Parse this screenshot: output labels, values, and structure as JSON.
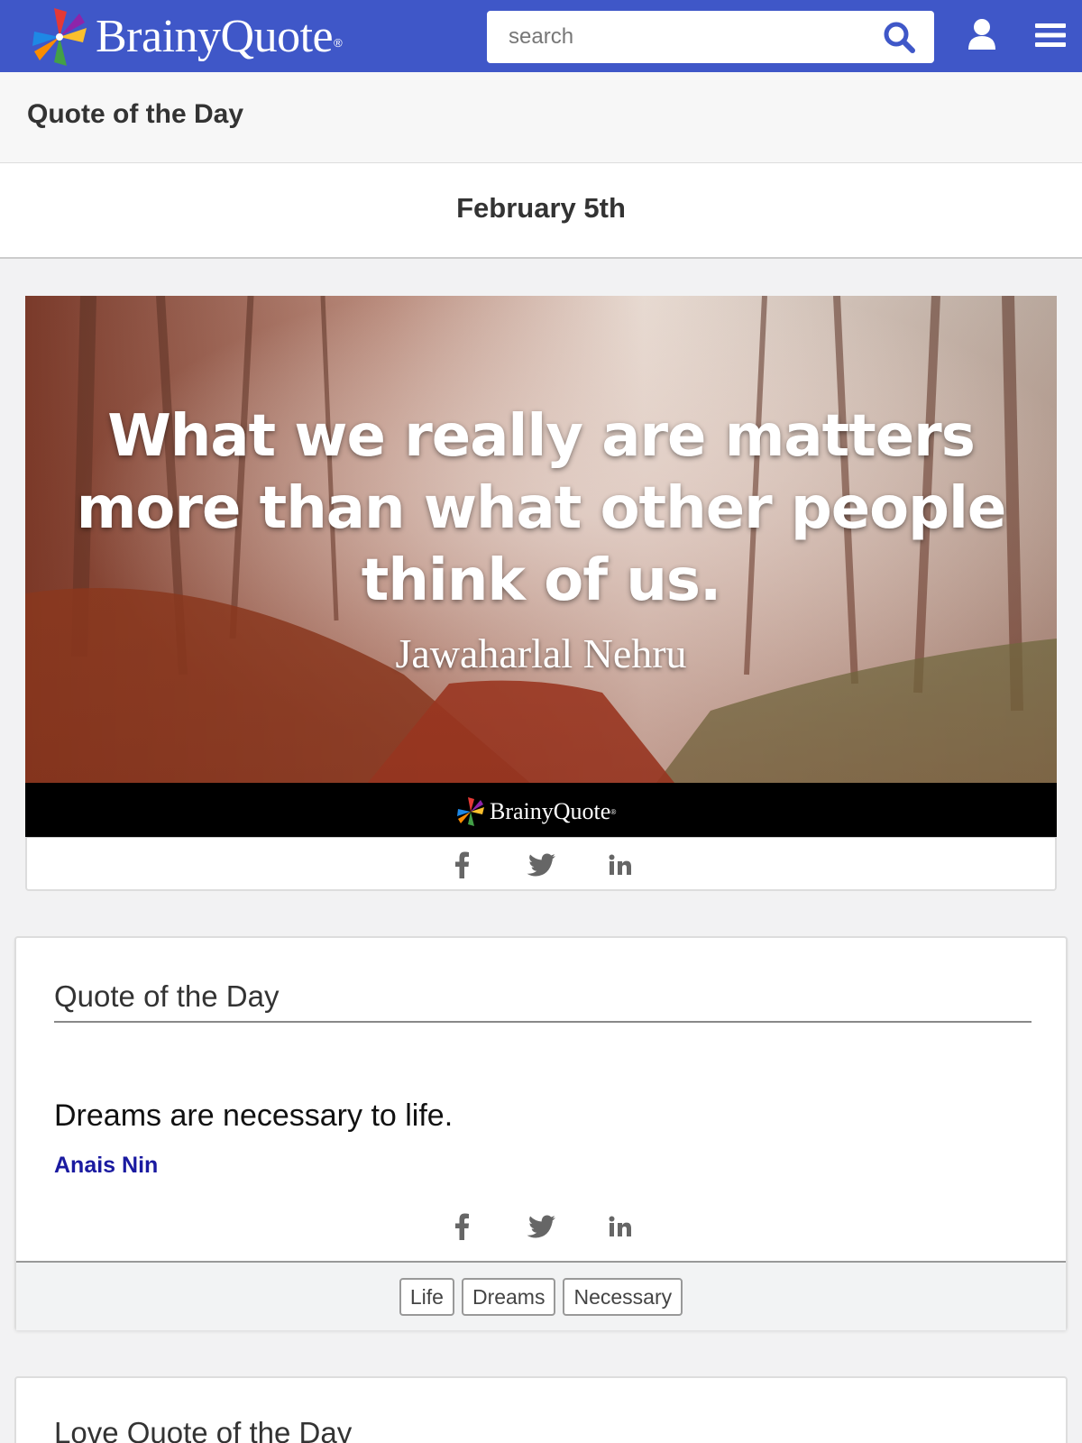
{
  "header": {
    "logo_text": "BrainyQuote",
    "logo_mark": "®",
    "search_placeholder": "search",
    "icons": [
      "search-icon",
      "user-icon",
      "menu-icon"
    ],
    "brand_color": "#3f57c8"
  },
  "section": {
    "title": "Quote of the Day",
    "date": "February 5th"
  },
  "featured": {
    "quote": "What we really are matters more than what other people think of us.",
    "author": "Jawaharlal Nehru",
    "strip_logo": "BrainyQuote",
    "share_icons": [
      "facebook-icon",
      "twitter-icon",
      "linkedin-icon"
    ]
  },
  "card": {
    "title": "Quote of the Day",
    "quote": "Dreams are necessary to life.",
    "author": "Anais Nin",
    "author_color": "#1a1aa0",
    "share_icons": [
      "facebook-icon",
      "twitter-icon",
      "linkedin-icon"
    ],
    "tags": [
      "Life",
      "Dreams",
      "Necessary"
    ]
  },
  "next_card": {
    "title": "Love Quote of the Day"
  }
}
